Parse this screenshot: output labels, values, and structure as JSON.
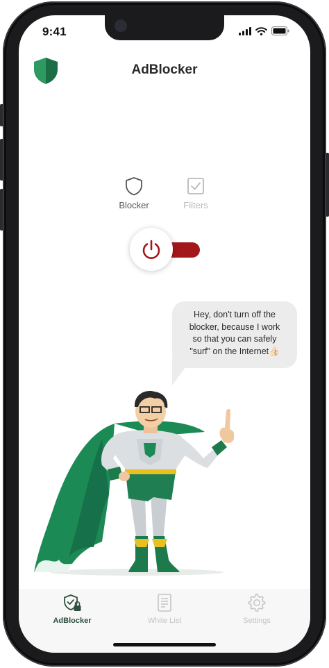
{
  "status_bar": {
    "time": "9:41",
    "icons": [
      "signal-icon",
      "wifi-icon",
      "battery-icon"
    ]
  },
  "header": {
    "title": "AdBlocker",
    "logo_icon": "shield-logo-icon"
  },
  "mode_tabs": [
    {
      "label": "Blocker",
      "icon": "shield-outline-icon",
      "active": true
    },
    {
      "label": "Filters",
      "icon": "checkbox-icon",
      "active": false
    }
  ],
  "power_toggle": {
    "icon": "power-icon",
    "state": "on",
    "accent_color": "#a3171b"
  },
  "speech_bubble": {
    "line1": "Hey, don't turn off the",
    "line2": "blocker, because I work",
    "line3": "so that you can safely",
    "line4": "\"surf\" on the Internet👍🏻"
  },
  "bottom_nav": {
    "items": [
      {
        "label": "AdBlocker",
        "icon": "shield-lock-icon",
        "active": true
      },
      {
        "label": "White List",
        "icon": "document-list-icon",
        "active": false
      },
      {
        "label": "Settings",
        "icon": "gear-icon",
        "active": false
      }
    ]
  },
  "colors": {
    "brand_green": "#1f7a4d",
    "power_red": "#a3171b",
    "active_nav": "#2f4f3f",
    "inactive": "#c3c3c3"
  }
}
